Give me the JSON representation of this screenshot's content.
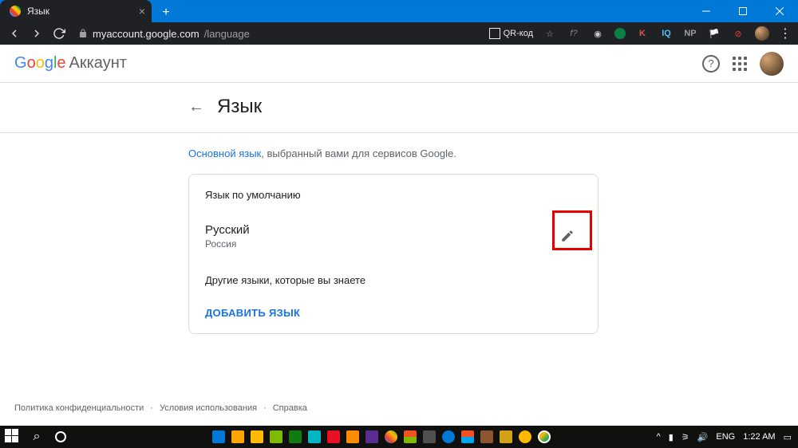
{
  "browser": {
    "tab_title": "Язык",
    "url_host": "myaccount.google.com",
    "url_path": "/language",
    "qr_label": "QR-код"
  },
  "header": {
    "logo_text": "Google",
    "account_label": "Аккаунт"
  },
  "page": {
    "title": "Язык",
    "desc_link": "Основной язык",
    "desc_rest": ", выбранный вами для сервисов Google."
  },
  "card": {
    "default_label": "Язык по умолчанию",
    "language_name": "Русский",
    "language_region": "Россия",
    "other_label": "Другие языки, которые вы знаете",
    "add_label": "ДОБАВИТЬ ЯЗЫК"
  },
  "footer": {
    "privacy": "Политика конфиденциальности",
    "terms": "Условия использования",
    "help": "Справка"
  },
  "tray": {
    "lang": "ENG",
    "time": "1:22 AM"
  }
}
